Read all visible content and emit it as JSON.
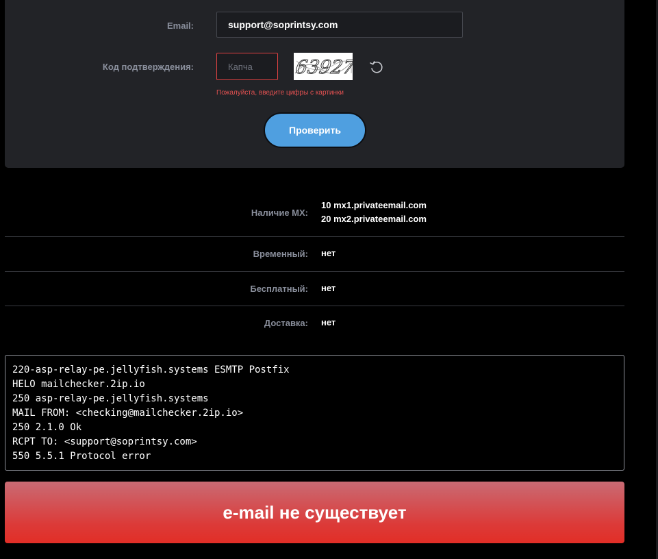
{
  "form": {
    "email_label": "Email:",
    "email_value": "support@soprintsy.com",
    "captcha_label": "Код подтверждения:",
    "captcha_placeholder": "Капча",
    "captcha_image_text": "63927",
    "captcha_error": "Пожалуйста, введите цифры с картинки",
    "check_button": "Проверить"
  },
  "results": {
    "mx": {
      "label": "Наличие MX:",
      "values": [
        "10 mx1.privateemail.com",
        "20 mx2.privateemail.com"
      ]
    },
    "temporary": {
      "label": "Временный:",
      "value": "нет"
    },
    "free": {
      "label": "Бесплатный:",
      "value": "нет"
    },
    "delivery": {
      "label": "Доставка:",
      "value": "нет"
    }
  },
  "smtp_log": [
    "220-asp-relay-pe.jellyfish.systems ESMTP Postfix",
    "HELO mailchecker.2ip.io",
    "250 asp-relay-pe.jellyfish.systems",
    "MAIL FROM: <checking@mailchecker.2ip.io>",
    "250 2.1.0 Ok",
    "RCPT TO: <support@soprintsy.com>",
    "550 5.5.1 Protocol error"
  ],
  "verdict": "e-mail не существует",
  "colors": {
    "panel": "#222327",
    "accent_button": "#4f9fe0",
    "error": "#e35151",
    "banner_red": "#e22e26"
  },
  "icons": {
    "refresh": "refresh-icon"
  }
}
